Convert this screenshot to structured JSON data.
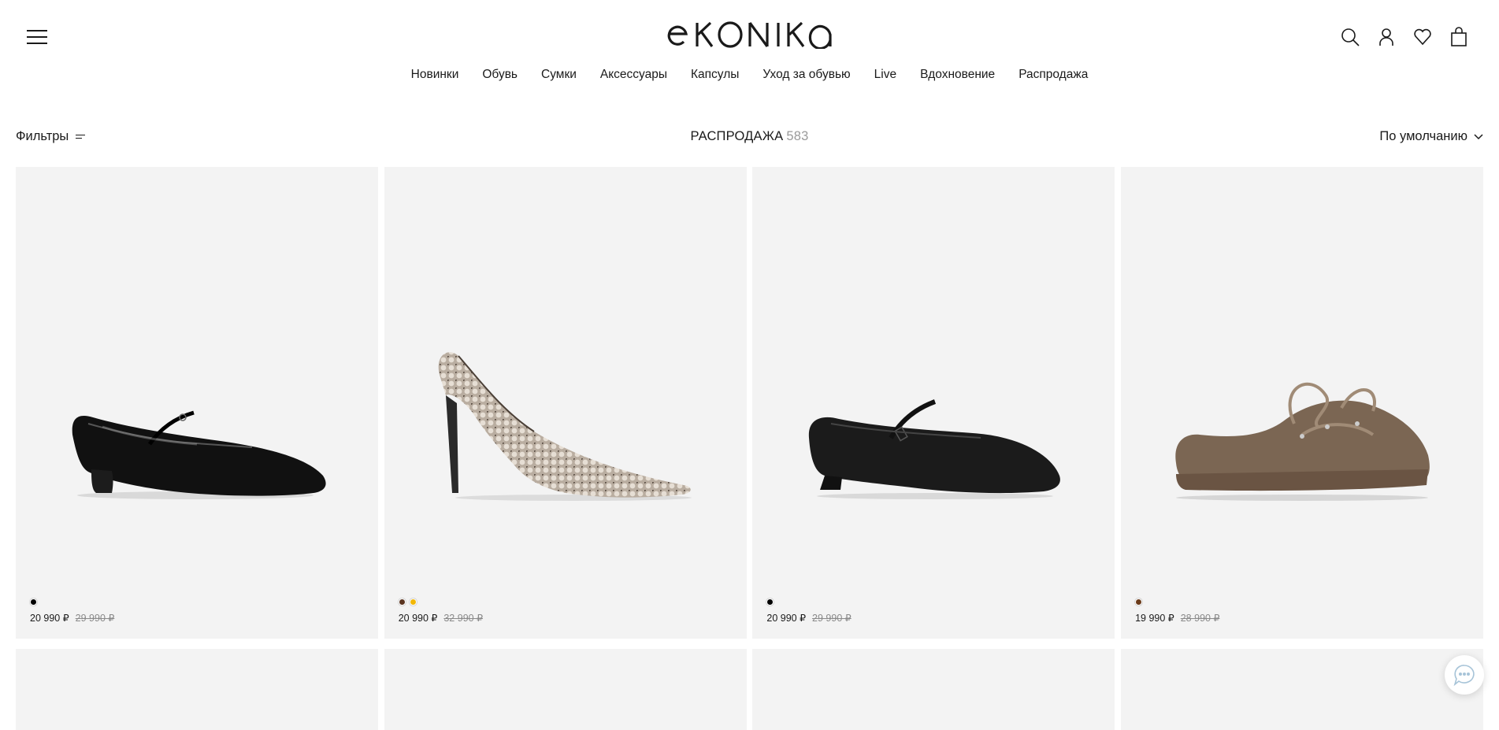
{
  "header": {
    "logo_text": "EKONIKA",
    "menu_icon": "menu-icon",
    "actions": [
      {
        "name": "search-icon"
      },
      {
        "name": "user-icon"
      },
      {
        "name": "heart-icon"
      },
      {
        "name": "bag-icon"
      }
    ]
  },
  "nav": {
    "items": [
      {
        "label": "Новинки"
      },
      {
        "label": "Обувь"
      },
      {
        "label": "Сумки"
      },
      {
        "label": "Аксессуары"
      },
      {
        "label": "Капсулы"
      },
      {
        "label": "Уход за обувью"
      },
      {
        "label": "Live"
      },
      {
        "label": "Вдохновение"
      },
      {
        "label": "Распродажа"
      }
    ]
  },
  "toolbar": {
    "filters_label": "Фильтры",
    "title": "РАСПРОДАЖА",
    "count": "583",
    "sort_label": "По умолчанию"
  },
  "products": [
    {
      "image": "black patent mary jane shoe",
      "swatches": [
        "#000000"
      ],
      "price": "20 990 ₽",
      "old_price": "29 990 ₽"
    },
    {
      "image": "snakeskin stiletto pump",
      "swatches": [
        "#5a3420",
        "#f2b705"
      ],
      "price": "20 990 ₽",
      "old_price": "32 990 ₽"
    },
    {
      "image": "black leather mary jane flat",
      "swatches": [
        "#000000"
      ],
      "price": "20 990 ₽",
      "old_price": "29 990 ₽"
    },
    {
      "image": "brown suede laced mule",
      "swatches": [
        "#6b3b1a"
      ],
      "price": "19 990 ₽",
      "old_price": "28 990 ₽"
    }
  ],
  "chat": {
    "icon": "chat-icon"
  }
}
